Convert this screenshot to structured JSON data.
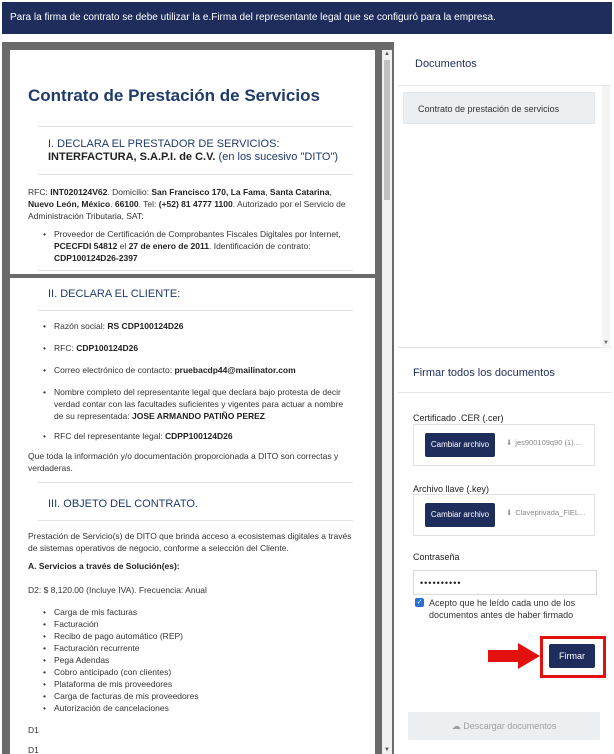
{
  "banner": {
    "text": "Para la firma de contrato se debe utilizar la e.Firma del representante legal que se configuró para la empresa."
  },
  "document": {
    "title": "Contrato de Prestación de Servicios",
    "section1": {
      "heading_line1": "I. DECLARA EL PRESTADOR DE SERVICIOS:",
      "heading_bold": "INTERFACTURA, S.A.P.I. de C.V.",
      "heading_rest": " (en los sucesivo \"DITO\")"
    },
    "rfc_para": {
      "t1": "RFC: ",
      "b1": "INT020124V62",
      "t2": ". Domicilio: ",
      "b2": "San Francisco 170, La Fama",
      "t3": ", ",
      "b3": "Santa Catarina",
      "t4": ", ",
      "b4": "Nuevo León, México",
      "t5": ". ",
      "b5": "66100",
      "t6": ". Tel: ",
      "b6": "(+52) 81 4777 1100",
      "t7": ". Autorizado por el Servicio de Administración Tributaria, SAT:"
    },
    "pac_item": {
      "t1": "Proveedor de Certificación de Comprobantes Fiscales Digitales por Internet, ",
      "b1": "PCECFDI 54812",
      "t2": " el ",
      "b2": "27 de enero de 2011",
      "t3": ". Identificación de contrato: ",
      "b3": "CDP100124D26-2397"
    },
    "section2": {
      "heading": "II. DECLARA EL CLIENTE:"
    },
    "client_items": [
      {
        "label": "Razón social: ",
        "value": "RS CDP100124D26"
      },
      {
        "label": "RFC: ",
        "value": "CDP100124D26"
      },
      {
        "label": "Correo electrónico de contacto: ",
        "value": "pruebacdp44@mailinator.com"
      },
      {
        "label": "Nombre completo del representante legal que declara bajo protesta de decir verdad contar con las facultades suficientes y vigentes para actuar a nombre de su representada: ",
        "value": "JOSE ARMANDO PATIÑO PEREZ"
      },
      {
        "label": "RFC del representante legal: ",
        "value": "CDPP100124D26"
      }
    ],
    "client_conclusion": "Que toda la información y/o documentación proporcionada a DITO son correctas y verdaderas.",
    "section3": {
      "heading": "III. OBJETO DEL CONTRATO."
    },
    "object_para": "Prestación de Servicio(s) de DITO que brinda acceso a ecosistemas digitales a través de sistemas operativos de negocio, conforme a selección del Cliente.",
    "services_heading": "A. Servicios a través de Solución(es):",
    "price_line": "D2: $ 8,120.00 (Incluye IVA). Frecuencia: Anual",
    "services": [
      "Carga de mis facturas",
      "Facturación",
      "Recibo de pago automático (REP)",
      "Facturación recurrente",
      "Pega Adendas",
      "Cobro anticipado (con clientes)",
      "Plataforma de mis proveedores",
      "Carga de facturas de mis proveedores",
      "Autorización de cancelaciones"
    ],
    "d1_a": "D1",
    "d1_b": "D1"
  },
  "panel": {
    "documents_title": "Documentos",
    "documents": [
      "Contrato de prestación de servicios"
    ],
    "sign_title": "Firmar todos los documentos",
    "cer_label": "Certificado .CER (.cer)",
    "cer_button": "Cambiar archivo",
    "cer_file": "jes900109q90 (1)....",
    "key_label": "Archivo llave (.key)",
    "key_button": "Cambiar archivo",
    "key_file": "Claveprivada_FIEL...",
    "password_label": "Contraseña",
    "password_value": "••••••••••",
    "accept_label": "Acepto que he leído cada uno de los documentos antes de haber firmado",
    "sign_button": "Firmar",
    "download_button": "Descargar documentos"
  },
  "colors": {
    "navy": "#1f2d5c",
    "highlight": "#e31010",
    "checkbox": "#2a6fd6"
  }
}
